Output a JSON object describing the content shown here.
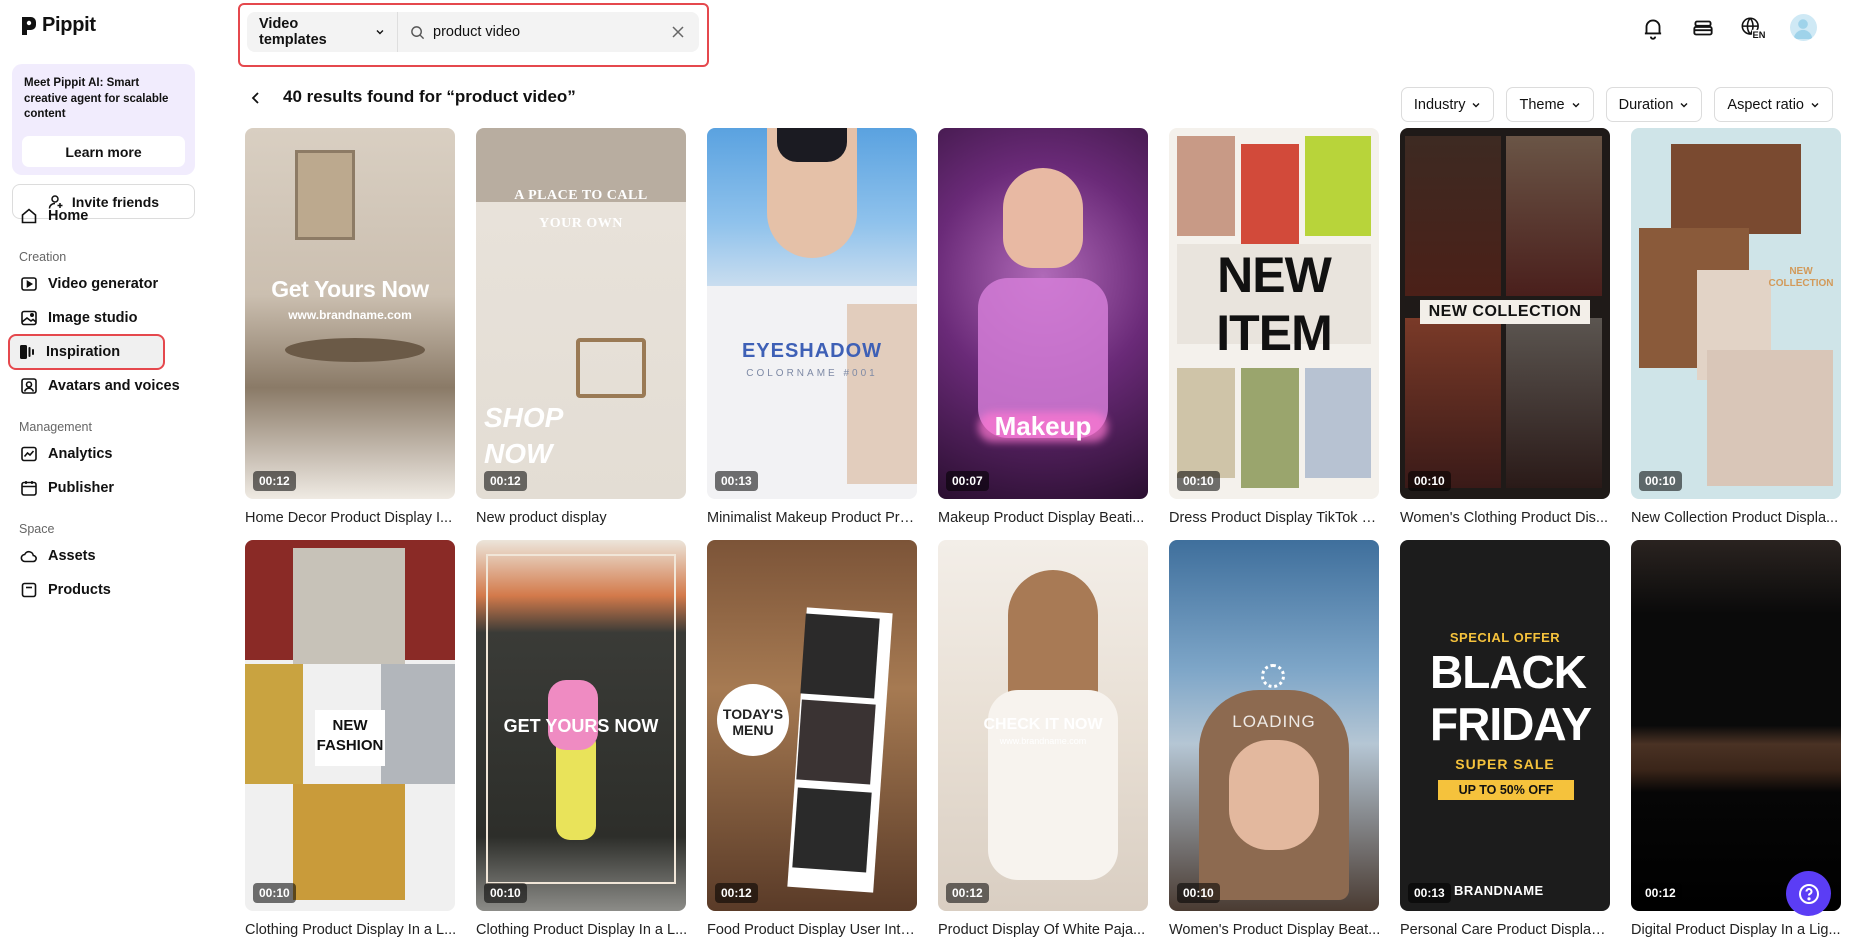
{
  "app": {
    "name": "Pippit"
  },
  "promo": {
    "text": "Meet Pippit AI: Smart creative agent for scalable content",
    "button": "Learn more"
  },
  "sidebar": {
    "invite": "Invite friends",
    "home": "Home",
    "sections": {
      "creation": "Creation",
      "management": "Management",
      "space": "Space"
    },
    "creation_items": [
      {
        "label": "Video generator",
        "icon": "video-generator-icon"
      },
      {
        "label": "Image studio",
        "icon": "image-studio-icon"
      },
      {
        "label": "Inspiration",
        "icon": "inspiration-icon",
        "active": true
      },
      {
        "label": "Avatars and voices",
        "icon": "avatar-icon"
      }
    ],
    "management_items": [
      {
        "label": "Analytics",
        "icon": "analytics-icon"
      },
      {
        "label": "Publisher",
        "icon": "calendar-icon"
      }
    ],
    "space_items": [
      {
        "label": "Assets",
        "icon": "cloud-icon"
      },
      {
        "label": "Products",
        "icon": "box-icon"
      }
    ]
  },
  "search": {
    "type": "Video templates",
    "query": "product video"
  },
  "topbar": {
    "language": "EN",
    "icons": [
      "bell-icon",
      "stack-icon",
      "globe-icon",
      "avatar"
    ]
  },
  "results": {
    "title": "40 results found for “product video”"
  },
  "filters": [
    "Industry",
    "Theme",
    "Duration",
    "Aspect ratio"
  ],
  "cards": [
    {
      "title": "Home Decor Product Display I...",
      "duration": "00:12",
      "overlay": "Get Yours Now",
      "sub": "www.brandname.com"
    },
    {
      "title": "New product display",
      "duration": "00:12",
      "overlay": "SHOP NOW",
      "sub": "A PLACE TO CALL YOUR OWN"
    },
    {
      "title": "Minimalist Makeup Product Pro...",
      "duration": "00:13",
      "overlay": "EYESHADOW",
      "sub": "COLORNAME #001"
    },
    {
      "title": "Makeup Product Display Beati...",
      "duration": "00:07",
      "overlay": "Makeup",
      "sub": ""
    },
    {
      "title": "Dress Product Display TikTok S...",
      "duration": "00:10",
      "overlay": "NEW ITEM",
      "sub": ""
    },
    {
      "title": "Women's Clothing Product Dis...",
      "duration": "00:10",
      "overlay": "NEW COLLECTION",
      "sub": ""
    },
    {
      "title": "New Collection Product Displa...",
      "duration": "00:10",
      "overlay": "NEW COLLECTION",
      "sub": ""
    },
    {
      "title": "Clothing Product Display In a L...",
      "duration": "00:10",
      "overlay": "NEW FASHION",
      "sub": ""
    },
    {
      "title": "Clothing Product Display In a L...",
      "duration": "00:10",
      "overlay": "GET YOURS NOW",
      "sub": ""
    },
    {
      "title": "Food Product Display User Inte...",
      "duration": "00:12",
      "overlay": "TODAY'S MENU",
      "sub": ""
    },
    {
      "title": "Product Display Of White Paja...",
      "duration": "00:12",
      "overlay": "CHECK IT NOW",
      "sub": "www.brandname.com"
    },
    {
      "title": "Women's Product Display Beat...",
      "duration": "00:10",
      "overlay": "LOADING",
      "sub": ""
    },
    {
      "title": "Personal Care Product Display ...",
      "duration": "00:13",
      "overlay": "BLACK FRIDAY",
      "sub": "SPECIAL OFFER",
      "extra": "SUPER SALE",
      "badge": "UP TO 50% OFF",
      "brand": "BRANDNAME"
    },
    {
      "title": "Digital Product Display In a Lig...",
      "duration": "00:12",
      "overlay": "",
      "sub": ""
    }
  ],
  "colors": {
    "accent": "#e5484d",
    "promo_bg": "#f1ecfd",
    "fab": "#5b3df5"
  }
}
